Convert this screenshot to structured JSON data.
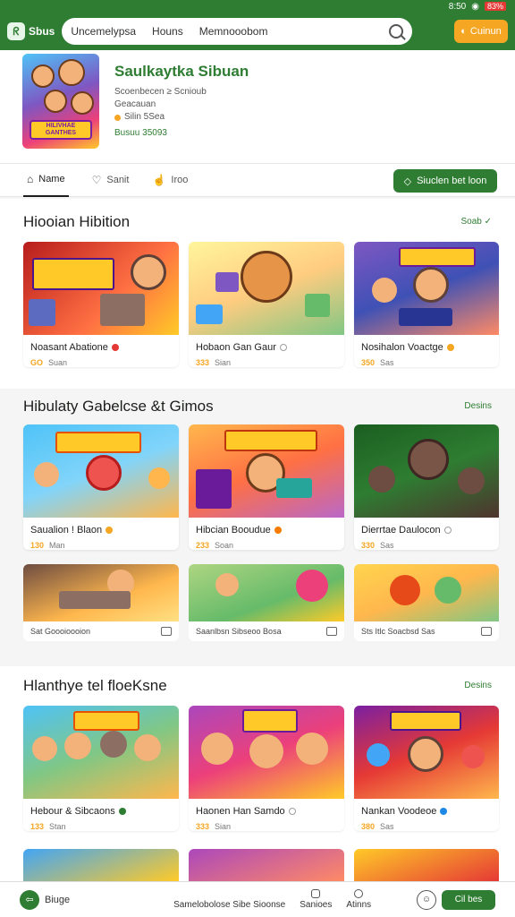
{
  "statusbar": {
    "time": "8:50",
    "battery": "83%"
  },
  "topbar": {
    "logo_text": "Sbus",
    "search_terms": [
      "Uncemelypsa",
      "Houns",
      "Memnooobom"
    ],
    "cta_label": "Cuinun"
  },
  "app": {
    "title": "Saulkaytka Sibuan",
    "subtitle": "Scoenbecen ≥ Scnioub",
    "subtitle2": "Geacauan",
    "rating": "Silin 5Sea",
    "installs": "Busuu 35093",
    "icon_banner": "HILIVHAE GANTHES"
  },
  "tabs": [
    {
      "label": "Name",
      "icon": "home-icon"
    },
    {
      "label": "Sanit",
      "icon": "chat-icon"
    },
    {
      "label": "Iroo",
      "icon": "hand-icon"
    }
  ],
  "action_button": "Siuclen bet loon",
  "sections": [
    {
      "title": "Hiooian Hibition",
      "link": "Soab",
      "cards": [
        {
          "name": "Noasant Abatione",
          "price": "GO",
          "sub": "Suan",
          "dot_color": "#e53935"
        },
        {
          "name": "Hobaon Gan Gaur",
          "price": "333",
          "sub": "Sian",
          "dot_color": "#9e9e9e"
        },
        {
          "name": "Nosihalon Voactge",
          "price": "350",
          "sub": "Sas",
          "dot_color": "#f5a623"
        }
      ]
    },
    {
      "title": "Hibulaty Gabelcse &t Gimos",
      "link": "Desins",
      "cards": [
        {
          "name": "Saualion ! Blaon",
          "price": "130",
          "sub": "Man",
          "dot_color": "#f5a623"
        },
        {
          "name": "Hibcian Booudue",
          "price": "233",
          "sub": "Soan",
          "dot_color": "#f57c00"
        },
        {
          "name": "Dierrtae Daulocon",
          "price": "330",
          "sub": "Sas",
          "dot_color": "#9e9e9e"
        }
      ],
      "small_cards": [
        {
          "caption": "Sat Goooioooion"
        },
        {
          "caption": "Saanlbsn Sibseoo Bosa"
        },
        {
          "caption": "Sts Itlc Soacbsd Sas"
        }
      ]
    },
    {
      "title": "Hlanthye tel floeKsne",
      "link": "Desins",
      "cards": [
        {
          "name": "Hebour & Sibcaons",
          "price": "133",
          "sub": "Stan",
          "dot_color": "#2e7d32"
        },
        {
          "name": "Haonen Han Samdo",
          "price": "333",
          "sub": "Sian",
          "dot_color": "#9e9e9e"
        },
        {
          "name": "Nankan Voodeoe",
          "price": "380",
          "sub": "Sas",
          "dot_color": "#1e88e5"
        }
      ]
    }
  ],
  "bottombar": {
    "logo_text": "Biuge",
    "links": [
      "Samelobolose Sibe Sioonse",
      "Sanioes",
      "Atinns"
    ],
    "button_label": "Cil bes"
  },
  "colors": {
    "primary": "#2e7d32",
    "accent": "#f5a623"
  }
}
